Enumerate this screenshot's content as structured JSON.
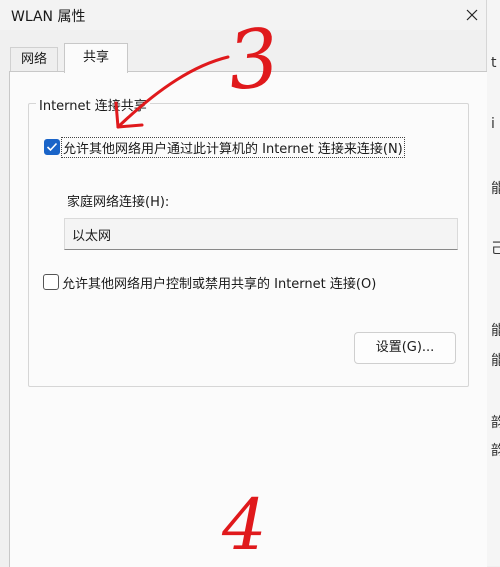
{
  "window": {
    "title": "WLAN 属性",
    "close_icon": "close-icon"
  },
  "tabs": [
    {
      "label": "网络",
      "active": false
    },
    {
      "label": "共享",
      "active": true
    }
  ],
  "group": {
    "title": "Internet 连接共享",
    "allow_connect": {
      "label": "允许其他网络用户通过此计算机的 Internet 连接来连接(N)",
      "checked": true
    },
    "home_network": {
      "label": "家庭网络连接(H):",
      "value": "以太网"
    },
    "allow_control": {
      "label": "允许其他网络用户控制或禁用共享的 Internet 连接(O)",
      "checked": false
    },
    "settings_button": "设置(G)..."
  },
  "annotations": {
    "step_3": "3",
    "step_4": "4",
    "color": "#e0191c"
  },
  "background_window_glyphs": [
    "t",
    "i",
    "能",
    "己",
    "能",
    "能",
    "韵",
    "韵"
  ]
}
